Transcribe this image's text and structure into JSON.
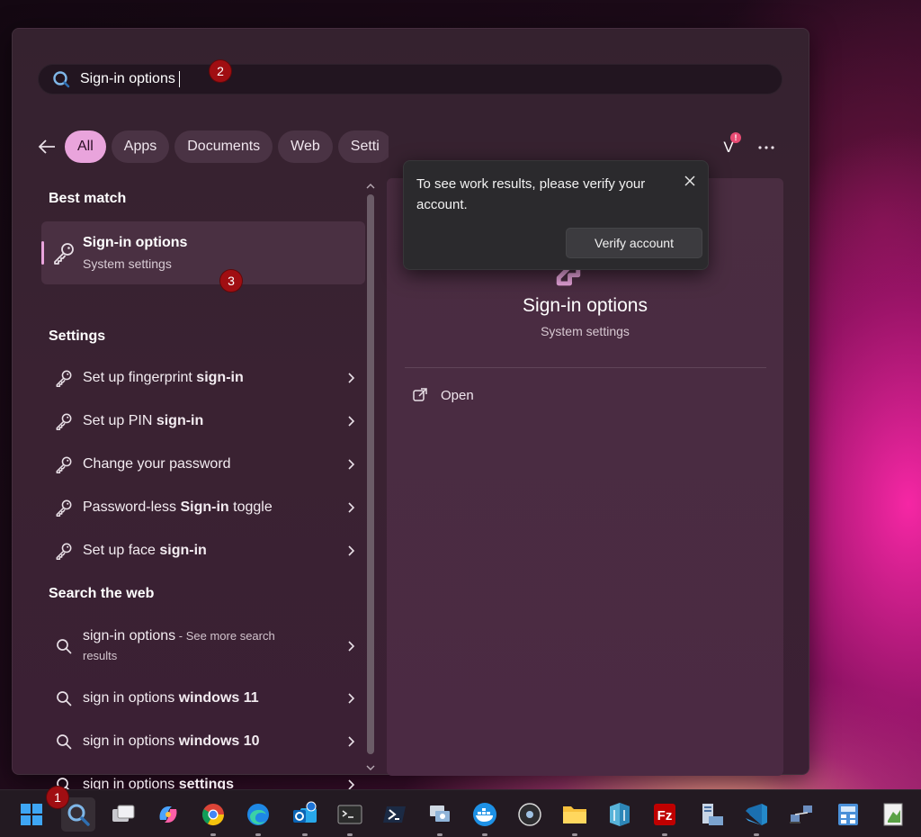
{
  "search": {
    "value": "Sign-in options",
    "annotation": "2"
  },
  "filters": {
    "tabs": [
      {
        "label": "All",
        "active": true
      },
      {
        "label": "Apps",
        "active": false
      },
      {
        "label": "Documents",
        "active": false
      },
      {
        "label": "Web",
        "active": false
      },
      {
        "label": "Setti",
        "active": false
      }
    ],
    "avatar_letter": "V",
    "avatar_badge": "!"
  },
  "best_match": {
    "heading": "Best match",
    "title": "Sign-in options",
    "subtitle": "System settings",
    "annotation": "3"
  },
  "settings": {
    "heading": "Settings",
    "items": [
      {
        "pre": "Set up fingerprint ",
        "bold": "sign-in",
        "post": ""
      },
      {
        "pre": "Set up PIN ",
        "bold": "sign-in",
        "post": ""
      },
      {
        "pre": "Change your password",
        "bold": "",
        "post": ""
      },
      {
        "pre": "Password-less ",
        "bold": "Sign-in",
        "post": " toggle"
      },
      {
        "pre": "Set up face ",
        "bold": "sign-in",
        "post": ""
      }
    ]
  },
  "web": {
    "heading": "Search the web",
    "first": {
      "main": "sign-in options",
      "suffix": " - See more search",
      "line2": "results"
    },
    "items": [
      {
        "pre": "sign in options ",
        "bold": "windows 11"
      },
      {
        "pre": "sign in options ",
        "bold": "windows 10"
      },
      {
        "pre": "sign in options ",
        "bold": "settings"
      }
    ]
  },
  "preview": {
    "title": "Sign-in options",
    "subtitle": "System settings",
    "open_label": "Open"
  },
  "toast": {
    "message": "To see work results, please verify your account.",
    "button": "Verify account"
  },
  "taskbar": {
    "annotation": "1",
    "icons": [
      "windows-start-icon",
      "search-icon",
      "task-view-icon",
      "copilot-icon",
      "chrome-icon",
      "edge-icon",
      "outlook-icon",
      "terminal-icon",
      "powershell-icon",
      "remote-desktop-icon",
      "docker-icon",
      "obs-icon",
      "file-explorer-icon",
      "azure-storage-icon",
      "filezilla-icon",
      "server-manager-icon",
      "vscode-icon",
      "network-icon",
      "calculator-icon",
      "notepad-icon"
    ]
  },
  "colors": {
    "accent": "#e9a4dc",
    "badge": "#a00e12",
    "panel": "#3a2232"
  }
}
